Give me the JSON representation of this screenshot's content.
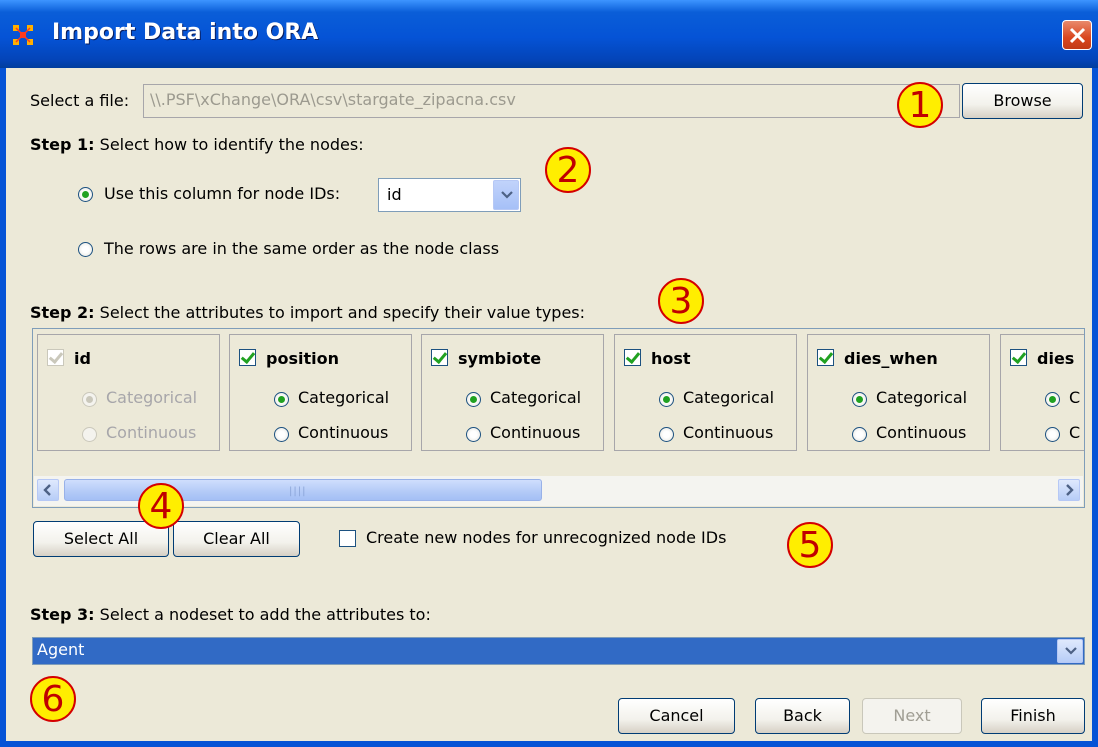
{
  "window": {
    "title": "Import Data into ORA"
  },
  "file": {
    "label": "Select a file:",
    "path": "\\\\.PSF\\xChange\\ORA\\csv\\stargate_zipacna.csv",
    "browse_label": "Browse"
  },
  "step1": {
    "heading": "Step 1:",
    "text": "Select how to identify the nodes:",
    "option_column_label": "Use this column for node IDs:",
    "column_value": "id",
    "option_order_label": "The rows are in the same order as the node class",
    "selected": "column"
  },
  "step2": {
    "heading": "Step 2:",
    "text": "Select the attributes to import and specify their value types:",
    "categorical_label": "Categorical",
    "continuous_label": "Continuous",
    "attributes": [
      {
        "name": "id",
        "checked": true,
        "enabled": false,
        "type": "Categorical"
      },
      {
        "name": "position",
        "checked": true,
        "enabled": true,
        "type": "Categorical"
      },
      {
        "name": "symbiote",
        "checked": true,
        "enabled": true,
        "type": "Categorical"
      },
      {
        "name": "host",
        "checked": true,
        "enabled": true,
        "type": "Categorical"
      },
      {
        "name": "dies_when",
        "checked": true,
        "enabled": true,
        "type": "Categorical"
      },
      {
        "name": "dies",
        "checked": true,
        "enabled": true,
        "type": "Categorical"
      }
    ],
    "cut_option_text": "C",
    "select_all_label": "Select All",
    "clear_all_label": "Clear All",
    "create_nodes_label": "Create new nodes for unrecognized node IDs",
    "create_nodes_checked": false
  },
  "step3": {
    "heading": "Step 3:",
    "text": "Select a nodeset to add the attributes to:",
    "nodeset_value": "Agent"
  },
  "footer": {
    "cancel_label": "Cancel",
    "back_label": "Back",
    "next_label": "Next",
    "finish_label": "Finish"
  },
  "callouts": [
    "1",
    "2",
    "3",
    "4",
    "5",
    "6"
  ],
  "colors": {
    "titlebar": "#0553d6",
    "dialog_bg": "#ece9d8",
    "selection": "#316ac5",
    "callout_fill": "#ffee00",
    "callout_text": "#c00000",
    "radio_check": "#21a121"
  }
}
